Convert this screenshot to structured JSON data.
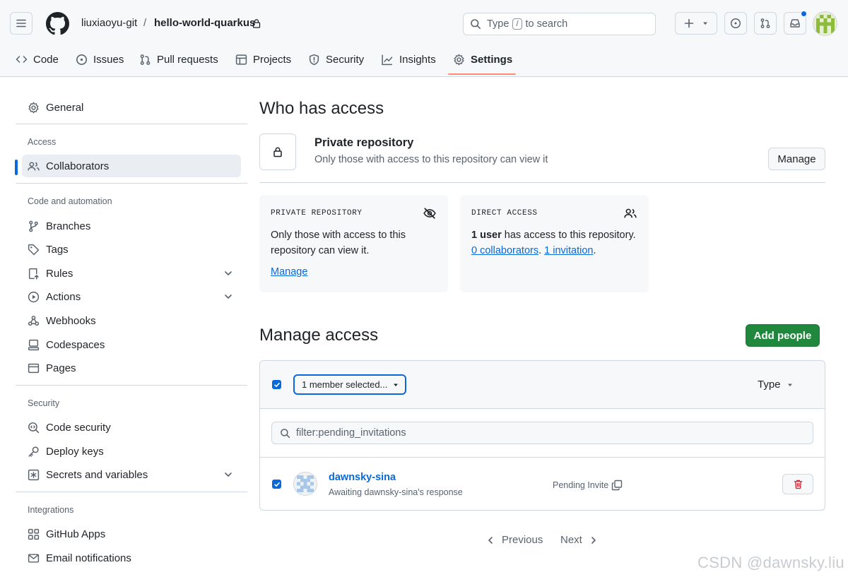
{
  "header": {
    "owner": "liuxiaoyu-git",
    "separator": "/",
    "repo": "hello-world-quarkus",
    "search": {
      "pre": "Type",
      "key": "/",
      "post": "to search"
    }
  },
  "tabs": [
    {
      "label": "Code",
      "icon": "code-icon"
    },
    {
      "label": "Issues",
      "icon": "issue-opened-icon"
    },
    {
      "label": "Pull requests",
      "icon": "git-pull-request-icon"
    },
    {
      "label": "Projects",
      "icon": "table-icon"
    },
    {
      "label": "Security",
      "icon": "shield-icon"
    },
    {
      "label": "Insights",
      "icon": "graph-icon"
    },
    {
      "label": "Settings",
      "icon": "gear-icon",
      "selected": true
    }
  ],
  "sidebar": {
    "general": "General",
    "sections": {
      "access": "Access",
      "code_automation": "Code and automation",
      "security": "Security",
      "integrations": "Integrations"
    },
    "items": {
      "collaborators": "Collaborators",
      "branches": "Branches",
      "tags": "Tags",
      "rules": "Rules",
      "actions": "Actions",
      "webhooks": "Webhooks",
      "codespaces": "Codespaces",
      "pages": "Pages",
      "code_security": "Code security",
      "deploy_keys": "Deploy keys",
      "secrets": "Secrets and variables",
      "github_apps": "GitHub Apps",
      "email_notifications": "Email notifications"
    }
  },
  "who": {
    "title": "Who has access",
    "private_title": "Private repository",
    "private_desc": "Only those with access to this repository can view it",
    "manage": "Manage"
  },
  "cards": {
    "private": {
      "heading": "PRIVATE REPOSITORY",
      "text": "Only those with access to this repository can view it.",
      "link": "Manage"
    },
    "direct": {
      "heading": "DIRECT ACCESS",
      "users": "1 user",
      "text": " has access to this repository.",
      "collaborators": "0 collaborators",
      "period1": ".",
      "invitation": "1 invitation",
      "period2": "."
    }
  },
  "manage": {
    "title": "Manage access",
    "add_people": "Add people",
    "selected_label": "1 member selected...",
    "type_label": "Type",
    "filter_value": "filter:pending_invitations",
    "member": {
      "name": "dawnsky-sina",
      "status": "Awaiting dawnsky-sina's response",
      "badge": "Pending Invite"
    }
  },
  "pagination": {
    "previous": "Previous",
    "next": "Next"
  },
  "watermark": "CSDN @dawnsky.liu",
  "colors": {
    "accent": "#0969da",
    "primary_button": "#1f883d",
    "danger": "#cf222e",
    "tab_underline": "#fd8c73"
  }
}
